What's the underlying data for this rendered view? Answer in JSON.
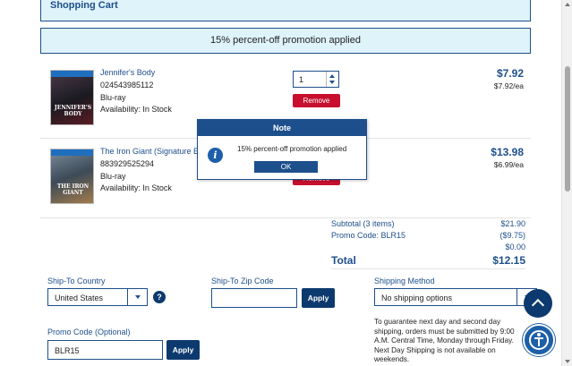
{
  "header": {
    "title": "Shopping Cart"
  },
  "promo_banner": "15% percent-off promotion applied",
  "items": [
    {
      "title": "Jennifer's Body",
      "upc": "024543985112",
      "format": "Blu-ray",
      "availability": "Availability: In Stock",
      "quantity": "1",
      "remove_label": "Remove",
      "price": "$7.92",
      "price_each": "$7.92/ea",
      "poster_text": "JENNIFER'S BODY"
    },
    {
      "title": "The Iron Giant (Signature E",
      "upc": "883929525294",
      "format": "Blu-ray",
      "availability": "Availability: In Stock",
      "remove_label": "Remove",
      "price": "$13.98",
      "price_each": "$6.99/ea",
      "poster_text": "THE IRON GIANT"
    }
  ],
  "totals": {
    "subtotal_label": "Subtotal (3 items)",
    "subtotal_value": "$21.90",
    "promo_label": "Promo Code: BLR15",
    "promo_value": "($9.75)",
    "extra_value": "$0.00",
    "total_label": "Total",
    "total_value": "$12.15"
  },
  "shipping": {
    "country_label": "Ship-To Country",
    "country_value": "United States",
    "help_icon": "?",
    "zip_label": "Ship-To Zip Code",
    "zip_value": "",
    "zip_apply": "Apply",
    "method_label": "Shipping Method",
    "method_value": "No shipping options",
    "note": "To guarantee next day and second day shipping, orders must be submitted by 9:00 A.M. Central Time, Monday through Friday. Next Day Shipping is not available on weekends."
  },
  "promo": {
    "label": "Promo Code (Optional)",
    "value": "BLR15",
    "apply": "Apply"
  },
  "dialog": {
    "title": "Note",
    "message": "15% percent-off promotion applied",
    "ok_label": "OK",
    "icon_glyph": "i"
  },
  "icons": {
    "scroll_top": "chevron-up-icon",
    "accessibility": "accessibility-icon"
  },
  "colors": {
    "brand_blue": "#1d4f8c",
    "remove_red": "#c8102e",
    "banner_bg": "#dff3fb",
    "button_dark": "#0d3a6e"
  }
}
